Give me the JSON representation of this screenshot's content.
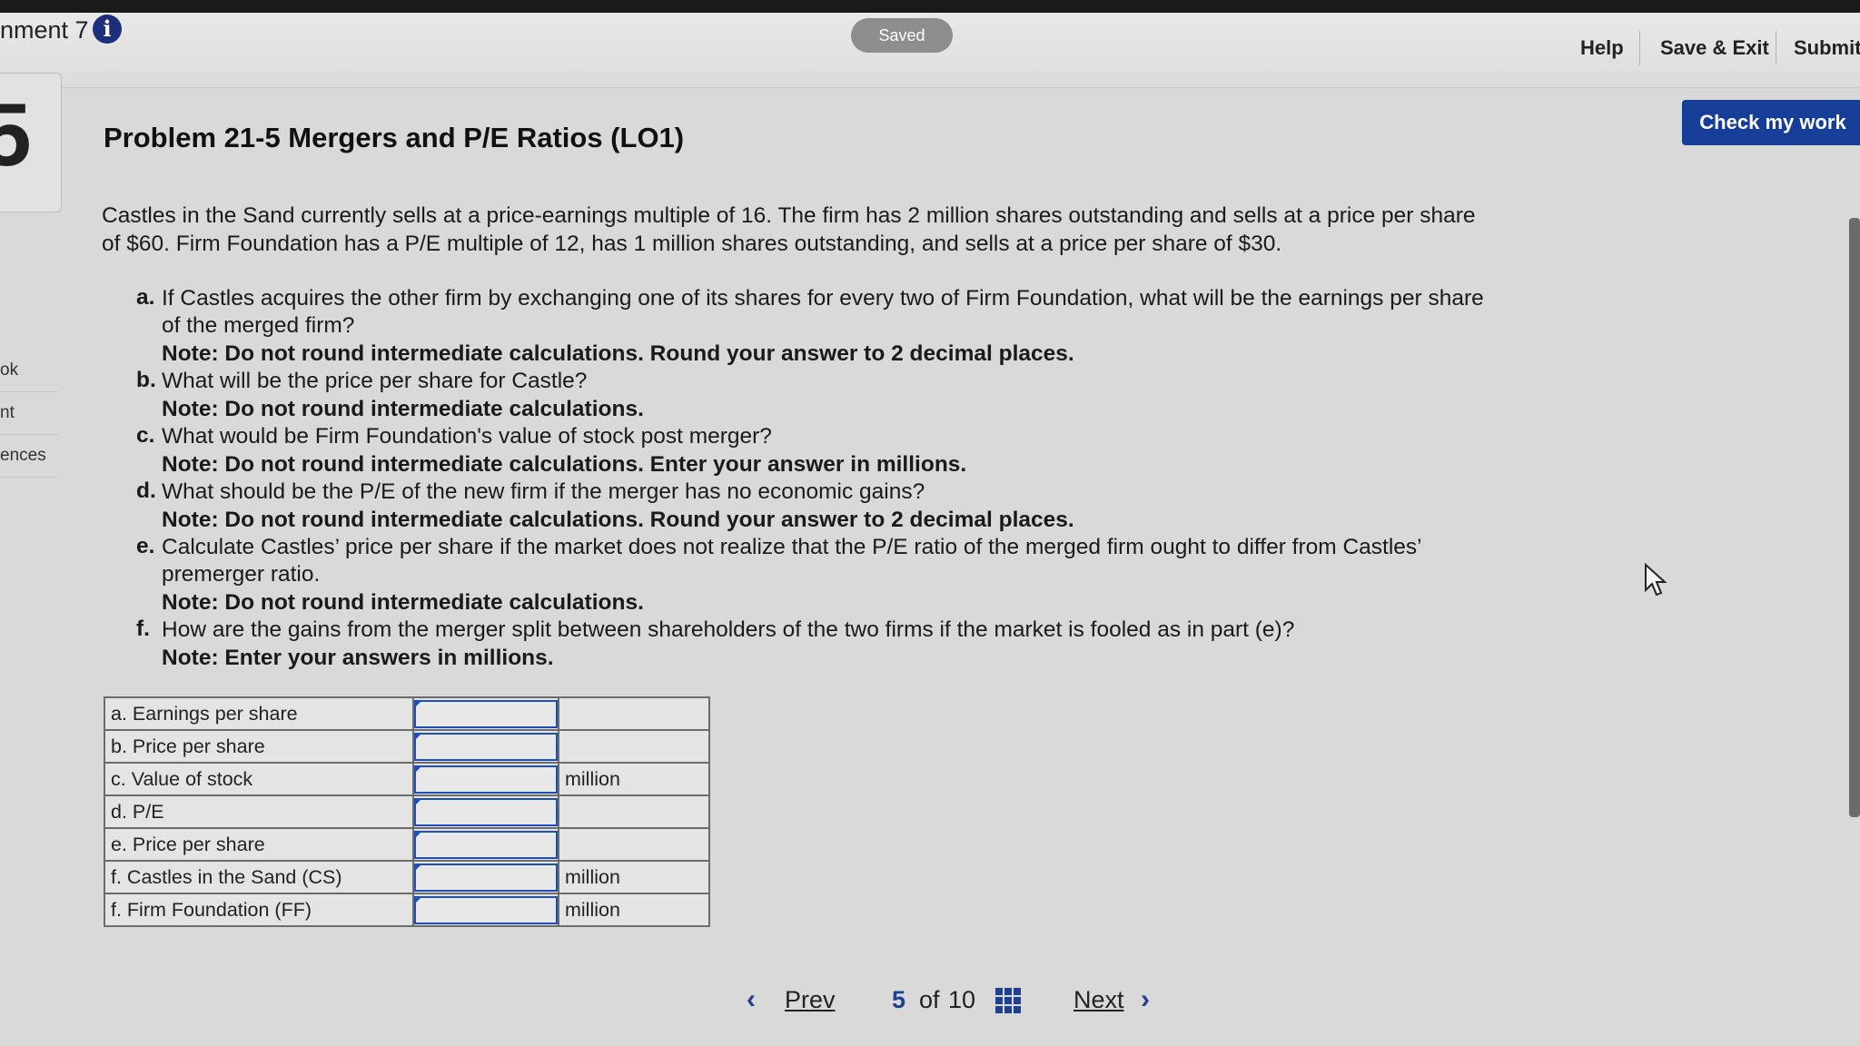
{
  "header": {
    "assignment_title": "nment 7",
    "info_icon": "info-icon",
    "saved_label": "Saved",
    "help_label": "Help",
    "save_exit_label": "Save & Exit",
    "submit_label": "Submit"
  },
  "sidebar": {
    "question_number": "5",
    "items": [
      {
        "label": "ok"
      },
      {
        "label": "nt"
      },
      {
        "label": "ences"
      }
    ]
  },
  "check_my_work_label": "Check my work",
  "problem": {
    "title": "Problem 21-5 Mergers and P/E Ratios (LO1)",
    "intro": "Castles in the Sand currently sells at a price-earnings multiple of 16. The firm has 2 million shares outstanding and sells at a price per share of $60. Firm Foundation has a P/E multiple of 12, has 1 million shares outstanding, and sells at a price per share of $30.",
    "questions": [
      {
        "letter": "a.",
        "text": "If Castles acquires the other firm by exchanging one of its shares for every two of Firm Foundation, what will be the earnings per share of the merged firm?",
        "note": "Note: Do not round intermediate calculations. Round your answer to 2 decimal places."
      },
      {
        "letter": "b.",
        "text": "What will be the price per share for Castle?",
        "note": "Note: Do not round intermediate calculations."
      },
      {
        "letter": "c.",
        "text": "What would be Firm Foundation's value of stock post merger?",
        "note": "Note: Do not round intermediate calculations. Enter your answer in millions."
      },
      {
        "letter": "d.",
        "text": "What should be the P/E of the new firm if the merger has no economic gains?",
        "note": "Note: Do not round intermediate calculations. Round your answer to 2 decimal places."
      },
      {
        "letter": "e.",
        "text": "Calculate Castles’ price per share if the market does not realize that the P/E ratio of the merged firm ought to differ from Castles’ premerger ratio.",
        "note": "Note: Do not round intermediate calculations."
      },
      {
        "letter": "f.",
        "text": "How are the gains from the merger split between shareholders of the two firms if the market is fooled as in part (e)?",
        "note": "Note: Enter your answers in millions."
      }
    ]
  },
  "answer_table": {
    "rows": [
      {
        "label": "a. Earnings per share",
        "value": "",
        "unit": ""
      },
      {
        "label": "b. Price per share",
        "value": "",
        "unit": ""
      },
      {
        "label": "c. Value of stock",
        "value": "",
        "unit": "million"
      },
      {
        "label": "d. P/E",
        "value": "",
        "unit": ""
      },
      {
        "label": "e. Price per share",
        "value": "",
        "unit": ""
      },
      {
        "label": "f. Castles in the Sand (CS)",
        "value": "",
        "unit": "million"
      },
      {
        "label": "f. Firm Foundation (FF)",
        "value": "",
        "unit": "million"
      }
    ]
  },
  "pagination": {
    "prev_label": "Prev",
    "current": "5",
    "of_label": "of",
    "total": "10",
    "next_label": "Next",
    "grid_icon": "grid-icon"
  },
  "colors": {
    "brand_blue": "#163e98",
    "input_border": "#1f4fb3",
    "saved_pill": "#8d8d8d"
  }
}
